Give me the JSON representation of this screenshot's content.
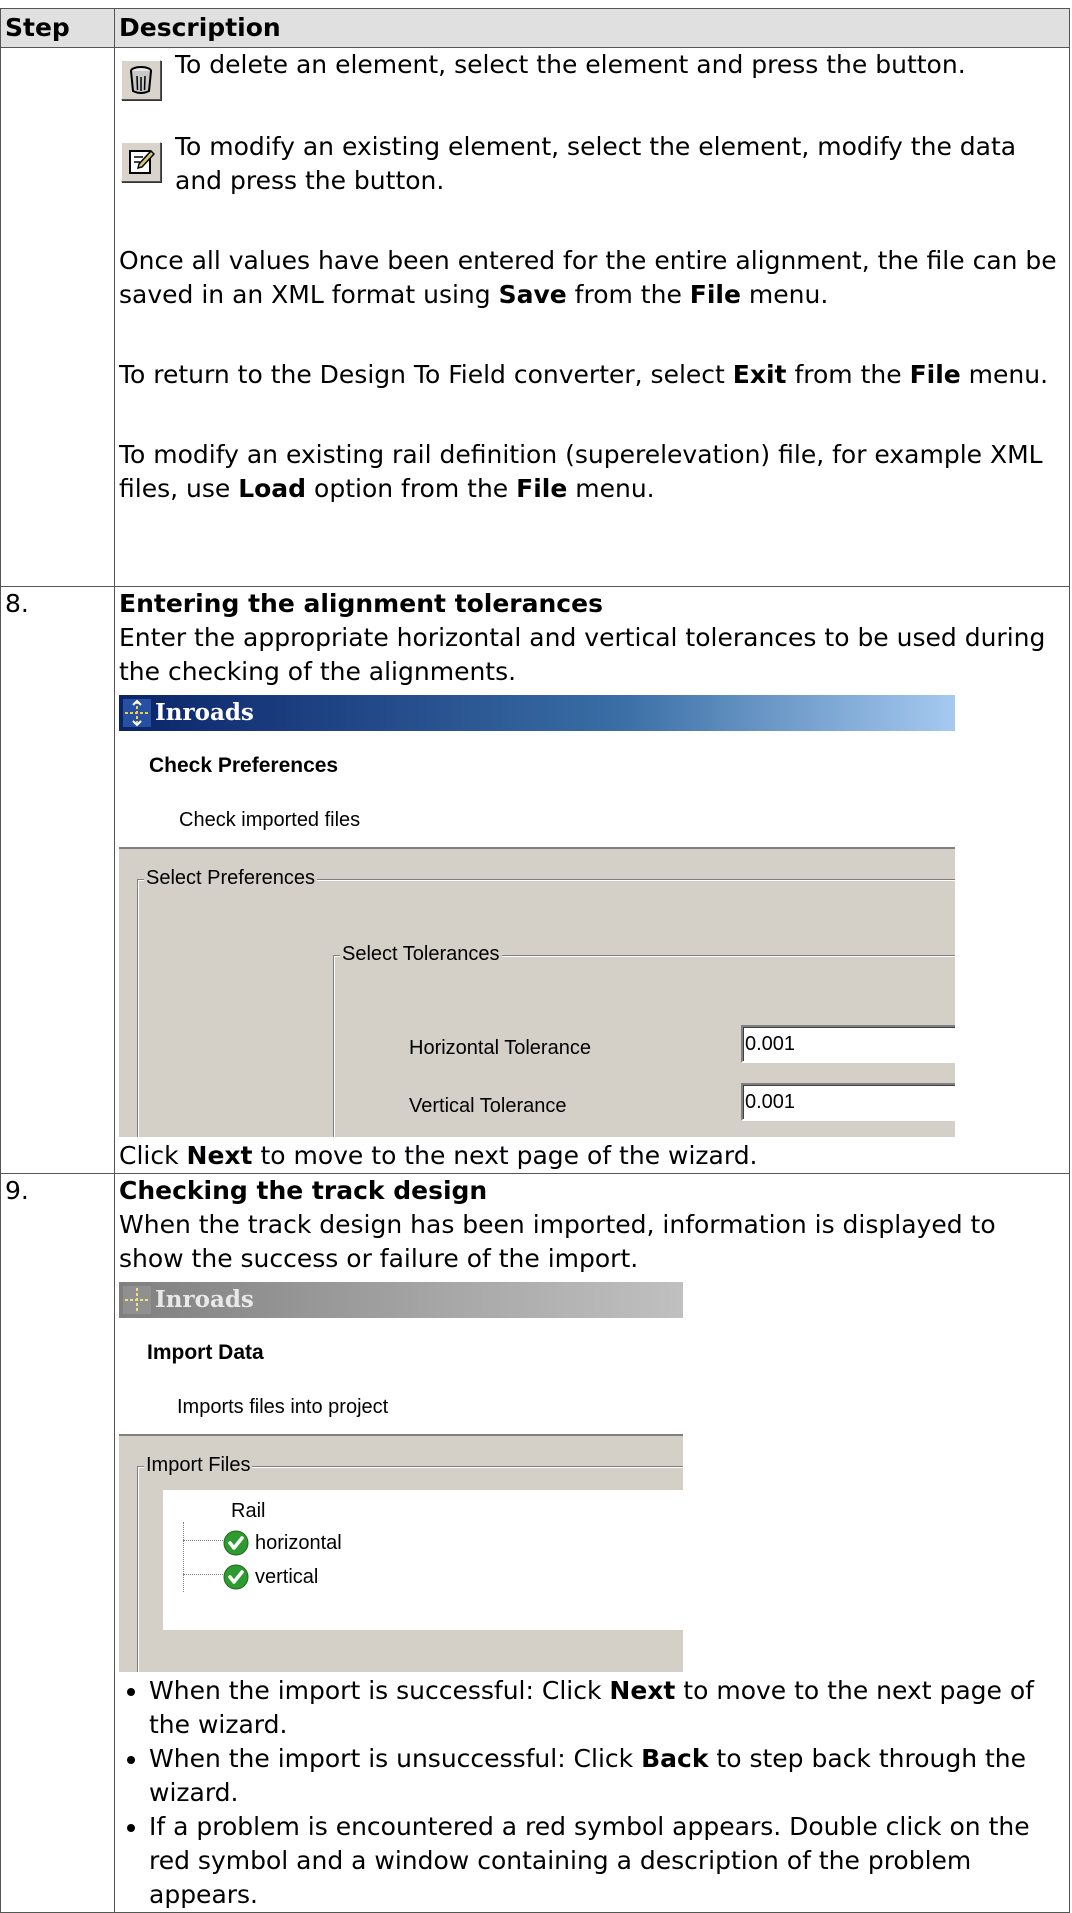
{
  "header": {
    "step": "Step",
    "description": "Description"
  },
  "row_continue": {
    "delete_text": "To delete an element, select the element and press the button.",
    "modify_text": "To modify an existing element, select the element, modify the data and press the button.",
    "save_pre": "Once all values have been entered for the entire alignment, the file can be saved in an XML format using ",
    "save_bold": "Save",
    "save_mid": " from the ",
    "save_file": "File",
    "save_post": " menu.",
    "exit_pre": "To return to the Design To Field converter, select ",
    "exit_bold": "Exit",
    "exit_mid": " from the ",
    "exit_file": "File",
    "exit_post": " menu.",
    "load_pre": "To modify an existing rail definition (superelevation) file, for example XML files, use ",
    "load_bold": "Load",
    "load_mid": " option from the ",
    "load_file": "File",
    "load_post": " menu."
  },
  "row8": {
    "step": "8.",
    "title": "Entering the alignment tolerances",
    "intro": "Enter the appropriate horizontal and vertical tolerances to be used during the checking of the alignments.",
    "dialog": {
      "window_title": "Inroads",
      "page_title": "Check Preferences",
      "page_subtitle": "Check imported files",
      "group_outer": "Select Preferences",
      "group_inner": "Select Tolerances",
      "horizontal_label": "Horizontal Tolerance",
      "horizontal_value": "0.001",
      "vertical_label": "Vertical Tolerance",
      "vertical_value": "0.001"
    },
    "next_pre": "Click ",
    "next_bold": "Next",
    "next_post": " to move to the next page of the wizard."
  },
  "row9": {
    "step": "9.",
    "title": "Checking the track design",
    "intro": "When the track design has been imported, information is displayed to show the success or failure of the import.",
    "dialog": {
      "window_title": "Inroads",
      "page_title": "Import Data",
      "page_subtitle": "Imports files into project",
      "group": "Import Files",
      "tree_root": "Rail",
      "tree_items": [
        "horizontal",
        "vertical"
      ]
    },
    "bullet1_pre": "When the import is successful: Click ",
    "bullet1_bold": "Next",
    "bullet1_post": " to move to the next page of the wizard.",
    "bullet2_pre": "When the import is unsuccessful: Click ",
    "bullet2_bold": "Back",
    "bullet2_post": " to step back through the wizard.",
    "bullet3": "If a problem is encountered a red symbol appears. Double click on the red symbol and a window containing a description of the problem appears."
  }
}
